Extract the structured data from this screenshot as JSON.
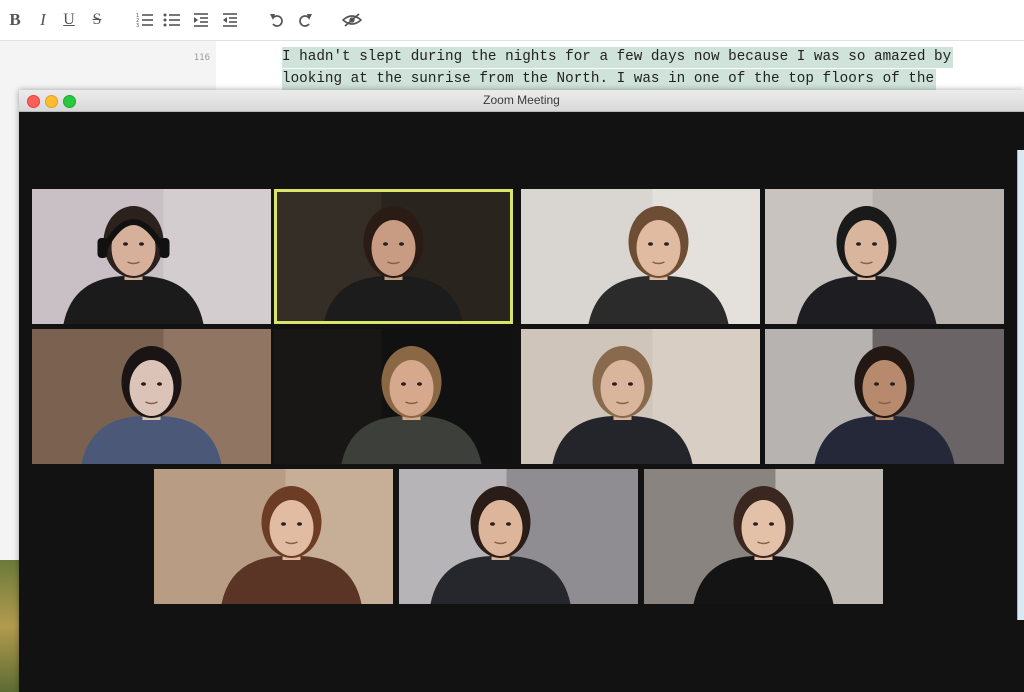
{
  "toolbar": {
    "bold_label": "B",
    "italic_label": "I",
    "underline_label": "U",
    "strike_label": "S",
    "icons": [
      "ordered-list-icon",
      "bullet-list-icon",
      "indent-icon",
      "outdent-icon",
      "undo-icon",
      "redo-icon",
      "hide-eye-icon"
    ]
  },
  "editor": {
    "line_number": "116",
    "lines": [
      "I hadn't slept during the nights for a few days now because I was so amazed by",
      "looking at the sunrise from the North. I was in one of the top floors of the"
    ]
  },
  "zoom": {
    "title": "Zoom Meeting",
    "active_participant_index": 1,
    "participants": [
      {
        "bg": "#c8c0c4",
        "wall": "#d9d3d6",
        "shirt": "#1b1b1b",
        "skin": "#d6b09a",
        "hair": "#2b211d",
        "headphones": true
      },
      {
        "bg": "#2a241f",
        "wall": "#3b332b",
        "shirt": "#1c1c1c",
        "skin": "#c79c82",
        "hair": "#2a1c15",
        "headphones": false
      },
      {
        "bg": "#d9d6d2",
        "wall": "#e8e5e1",
        "shirt": "#2b2b2b",
        "skin": "#e0bba2",
        "hair": "#6d4d33",
        "headphones": false
      },
      {
        "bg": "#b7b2ad",
        "wall": "#cfcac4",
        "shirt": "#1e1e22",
        "skin": "#d8b59c",
        "hair": "#1a1a1a",
        "headphones": false
      },
      {
        "bg": "#7b6250",
        "wall": "#9a7f69",
        "shirt": "#4c5877",
        "skin": "#dcc3b7",
        "hair": "#1a1414",
        "headphones": false
      },
      {
        "bg": "#111111",
        "wall": "#1c1a18",
        "shirt": "#3d3f3a",
        "skin": "#d6a88c",
        "hair": "#8a6846",
        "headphones": false
      },
      {
        "bg": "#cfc5bb",
        "wall": "#dbd2c8",
        "shirt": "#23252b",
        "skin": "#d9b59c",
        "hair": "#8a6a4c",
        "headphones": false
      },
      {
        "bg": "#6a6466",
        "wall": "#d8d4d0",
        "shirt": "#252839",
        "skin": "#b78a6e",
        "hair": "#241814",
        "headphones": false
      },
      {
        "bg": "#b89d84",
        "wall": "#cdb79f",
        "shirt": "#5a3424",
        "skin": "#e1bba2",
        "hair": "#6c3c25",
        "headphones": false
      },
      {
        "bg": "#8f8d91",
        "wall": "#c6c4c6",
        "shirt": "#26272c",
        "skin": "#dcb59b",
        "hair": "#2a1d17",
        "headphones": false
      },
      {
        "bg": "#8a8480",
        "wall": "#d5d0cb",
        "shirt": "#141414",
        "skin": "#e3c0a8",
        "hair": "#3a2720",
        "headphones": false
      }
    ]
  }
}
